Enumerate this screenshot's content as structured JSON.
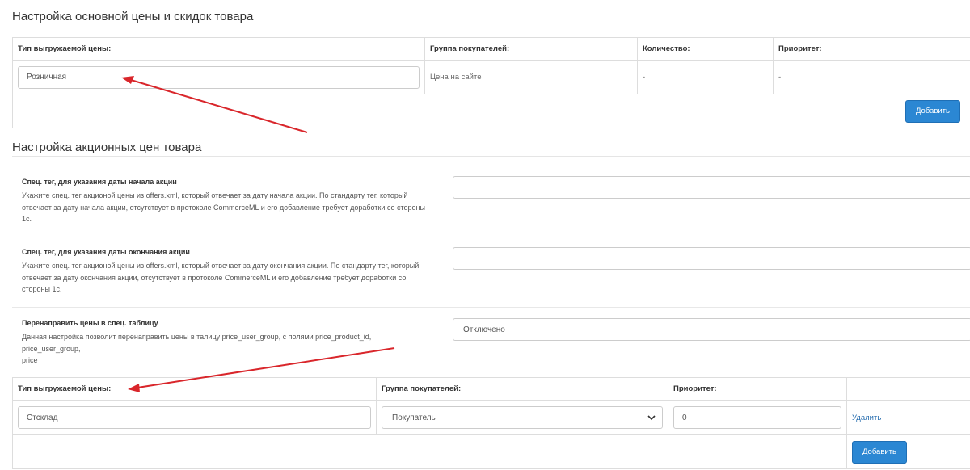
{
  "main_prices": {
    "legend": "Настройка основной цены и скидок товара",
    "headers": {
      "price_type": "Тип выгружаемой цены:",
      "customer_group": "Группа покупателей:",
      "quantity": "Количество:",
      "priority": "Приоритет:"
    },
    "row": {
      "price_type_value": "Розничная",
      "customer_group": "Цена на сайте",
      "quantity": "-",
      "priority": "-"
    },
    "add_label": "Добавить"
  },
  "promo": {
    "legend": "Настройка акционных цен товара",
    "start_tag": {
      "title": "Спец. тег, для указания даты начала акции",
      "help": "Укажите спец. тег акционой цены из offers.xml, который отвечает за дату начала акции. По стандарту тег, который отвечает за дату начала акции, отсутствует в протоколе CommerceML и его добавление требует доработки со стороны 1с.",
      "value": ""
    },
    "end_tag": {
      "title": "Спец. тег, для указания даты окончания акции",
      "help": "Укажите спец. тег акционой цены из offers.xml, который отвечает за дату окончания акции. По стандарту тег, который отвечает за дату окончания акции, отсутствует в протоколе CommerceML и его добавление требует доработки со стороны 1с.",
      "value": ""
    },
    "redirect": {
      "title": "Перенаправить цены в спец. таблицу",
      "help_line1": "Данная настройка позволит перенаправить цены в талицу price_user_group, с полями price_product_id,",
      "help_line2": "price_user_group,",
      "help_line3": "price",
      "value": "Отключено"
    }
  },
  "promo_prices": {
    "headers": {
      "price_type": "Тип выгружаемой цены:",
      "customer_group": "Группа покупателей:",
      "priority": "Приоритет:"
    },
    "row": {
      "price_type_value": "Стсклад",
      "customer_group": "Покупатель",
      "priority": "0",
      "delete_label": "Удалить"
    },
    "add_label": "Добавить"
  },
  "colors": {
    "accent": "#2b87d3",
    "arrow": "#d9262b",
    "link": "#2a6fb0"
  }
}
